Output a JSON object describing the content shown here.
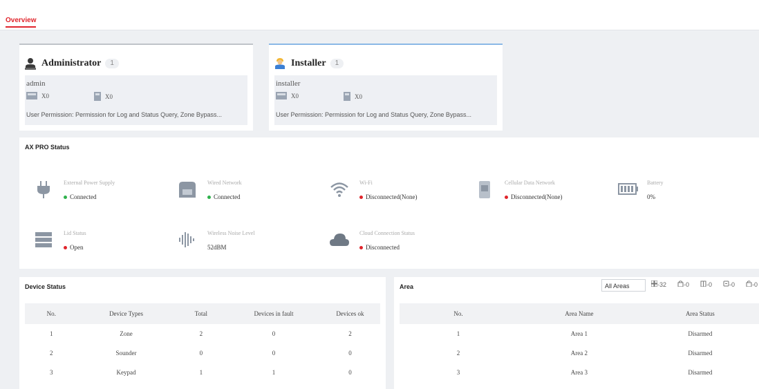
{
  "tabs": {
    "overview": "Overview"
  },
  "users": [
    {
      "title": "Administrator",
      "count": "1",
      "username": "admin",
      "stat1": "X0",
      "stat2": "X0",
      "permission": "User Permission:  Permission for Log and Status Query,  Zone Bypass..."
    },
    {
      "title": "Installer",
      "count": "1",
      "username": "installer",
      "stat1": "X0",
      "stat2": "X0",
      "permission": "User Permission:  Permission for Log and Status Query,  Zone Bypass..."
    }
  ],
  "ax_status": {
    "title": "AX PRO Status",
    "items": [
      {
        "label": "External Power Supply",
        "value": "Connected",
        "status_color": "#2fb14c",
        "icon": "power-plug-icon"
      },
      {
        "label": "Wired Network",
        "value": "Connected",
        "status_color": "#2fb14c",
        "icon": "wired-network-icon"
      },
      {
        "label": "Wi-Fi",
        "value": "Disconnected(None)",
        "status_color": "#e0242b",
        "icon": "wifi-icon"
      },
      {
        "label": "Cellular Data Network",
        "value": "Disconnected(None)",
        "status_color": "#e0242b",
        "icon": "cellular-icon"
      },
      {
        "label": "Battery",
        "value": "0%",
        "status_color": "",
        "icon": "battery-icon"
      },
      {
        "label": "Lid Status",
        "value": "Open",
        "status_color": "#e0242b",
        "icon": "lid-icon"
      },
      {
        "label": "Wireless Noise Level",
        "value": "52dBM",
        "status_color": "",
        "icon": "noise-level-icon"
      },
      {
        "label": "Cloud Connection Status",
        "value": "Disconnected",
        "status_color": "#e0242b",
        "icon": "cloud-icon"
      }
    ]
  },
  "device_status": {
    "title": "Device Status",
    "columns": [
      "No.",
      "Device Types",
      "Total",
      "Devices in fault",
      "Devices ok"
    ],
    "rows": [
      [
        "1",
        "Zone",
        "2",
        "0",
        "2"
      ],
      [
        "2",
        "Sounder",
        "0",
        "0",
        "0"
      ],
      [
        "3",
        "Keypad",
        "1",
        "1",
        "0"
      ]
    ]
  },
  "area": {
    "title": "Area",
    "select_value": "All Areas",
    "counts": [
      "-32",
      "-0",
      "-0",
      "-0",
      "-0"
    ],
    "columns": [
      "No.",
      "Area Name",
      "Area Status"
    ],
    "rows": [
      [
        "1",
        "Area 1",
        "Disarmed"
      ],
      [
        "2",
        "Area 2",
        "Disarmed"
      ],
      [
        "3",
        "Area 3",
        "Disarmed"
      ]
    ]
  },
  "colors": {
    "accent": "#e0242b",
    "connected": "#2fb14c"
  }
}
